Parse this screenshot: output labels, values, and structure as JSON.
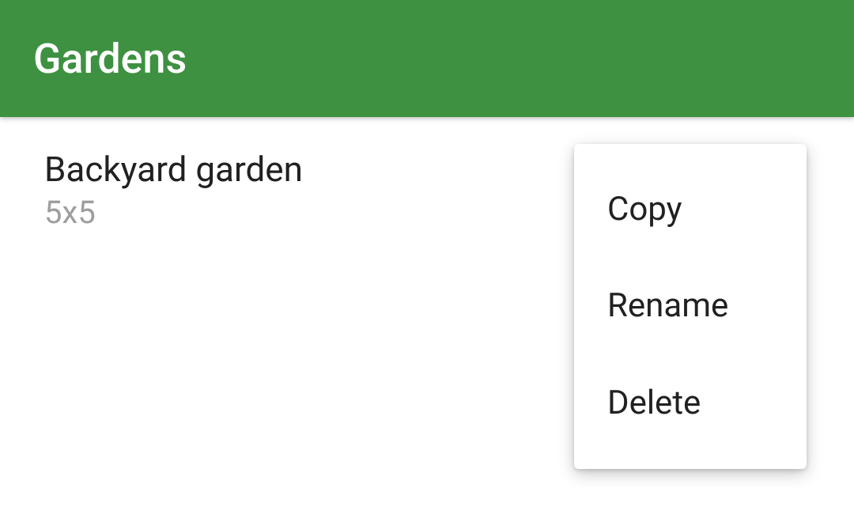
{
  "header": {
    "title": "Gardens"
  },
  "gardens": [
    {
      "name": "Backyard garden",
      "size": "5x5"
    }
  ],
  "context_menu": {
    "items": [
      {
        "label": "Copy"
      },
      {
        "label": "Rename"
      },
      {
        "label": "Delete"
      }
    ]
  }
}
